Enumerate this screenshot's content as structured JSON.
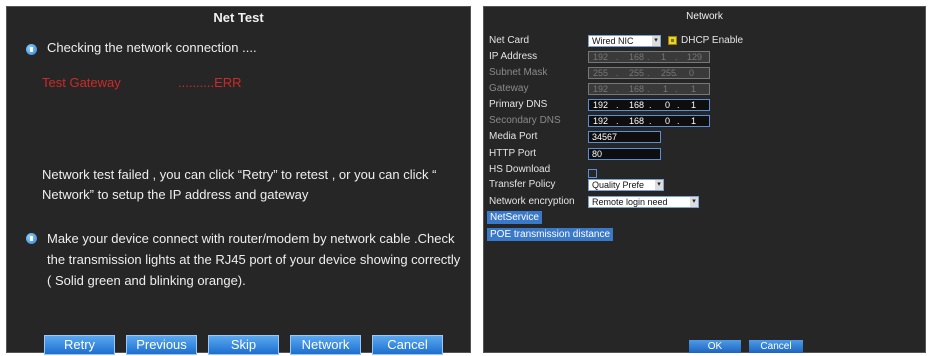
{
  "net_test": {
    "title": "Net Test",
    "checking": "Checking the network connection ....",
    "test_gateway_label": "Test Gateway",
    "test_gateway_status": "..........ERR",
    "fail_message": "Network test failed , you can click “Retry” to retest , or you can click “ Network” to setup the IP address and gateway",
    "hint": "Make your device connect with router/modem by network cable .Check the transmission lights at the RJ45 port of your device showing correctly ( Solid green and blinking orange).",
    "buttons": {
      "retry": "Retry",
      "previous": "Previous",
      "skip": "Skip",
      "network": "Network",
      "cancel": "Cancel"
    }
  },
  "network": {
    "title": "Network",
    "net_card": {
      "label": "Net Card",
      "value": "Wired NIC",
      "arrow": "▾"
    },
    "dhcp": {
      "label": "DHCP Enable",
      "checked": true
    },
    "ip_address": {
      "label": "IP Address",
      "octets": [
        "192",
        "168",
        "1",
        "129"
      ]
    },
    "subnet_mask": {
      "label": "Subnet Mask",
      "octets": [
        "255",
        "255",
        "255",
        "0"
      ]
    },
    "gateway": {
      "label": "Gateway",
      "octets": [
        "192",
        "168",
        "1",
        "1"
      ]
    },
    "primary_dns": {
      "label": "Primary DNS",
      "octets": [
        "192",
        "168",
        "0",
        "1"
      ]
    },
    "secondary_dns": {
      "label": "Secondary DNS",
      "octets": [
        "192",
        "168",
        "0",
        "1"
      ]
    },
    "media_port": {
      "label": "Media Port",
      "value": "34567"
    },
    "http_port": {
      "label": "HTTP Port",
      "value": "80"
    },
    "hs_download": {
      "label": "HS Download",
      "checked": false
    },
    "transfer_policy": {
      "label": "Transfer Policy",
      "value": "Quality Prefe",
      "arrow": "▾"
    },
    "network_encryption": {
      "label": "Network encryption",
      "value": "Remote login need",
      "arrow": "▾"
    },
    "netservice": "NetService",
    "poe": "POE transmission distance",
    "ok": "OK",
    "cancel": "Cancel"
  }
}
